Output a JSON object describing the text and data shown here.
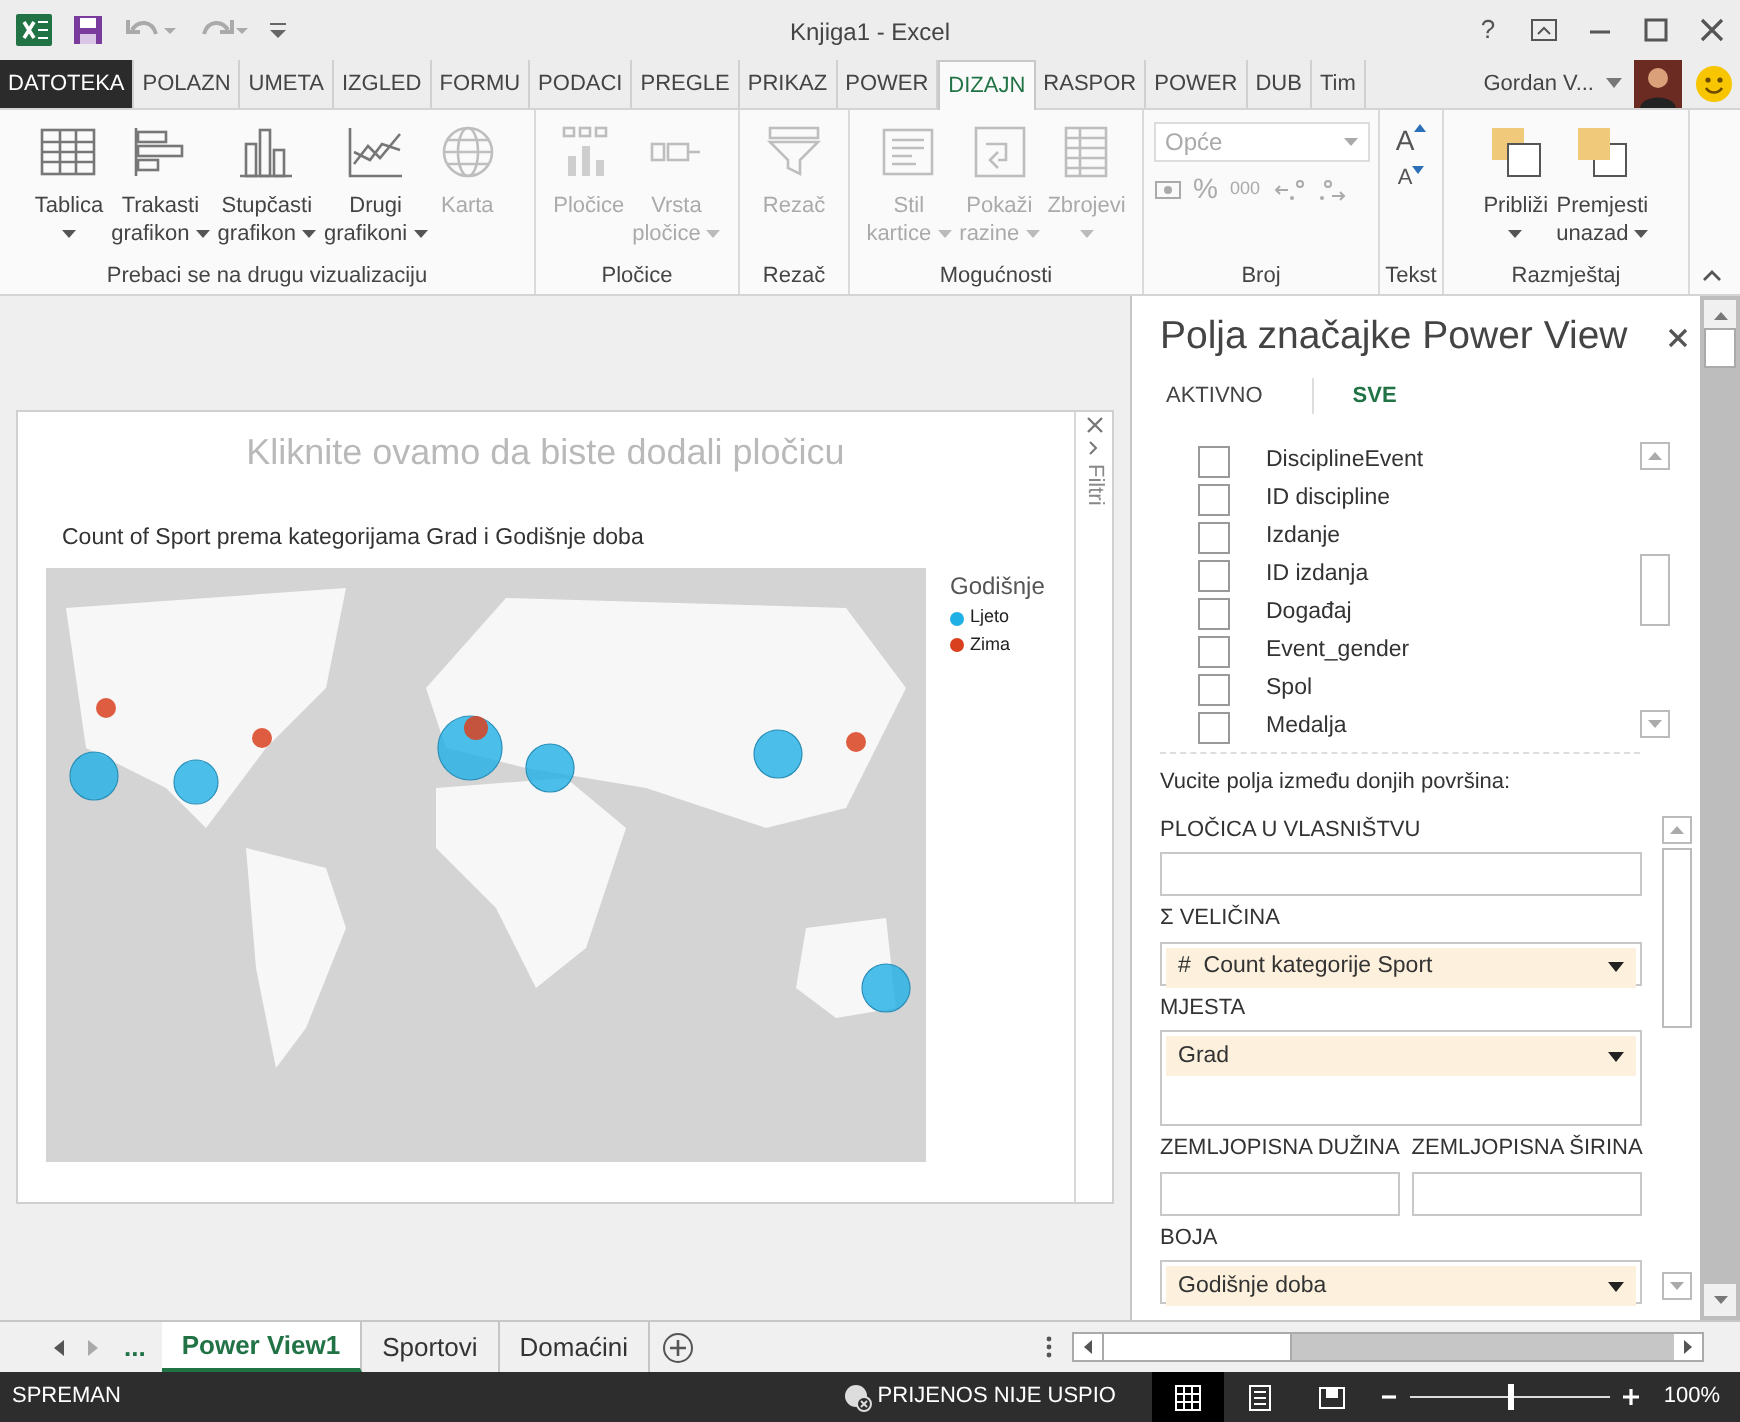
{
  "window": {
    "title": "Knjiga1 - Excel",
    "help": "?"
  },
  "ribbon_tabs": [
    {
      "label": "DATOTEKA",
      "kind": "file",
      "selected": false
    },
    {
      "label": "POLAZN",
      "kind": "tab",
      "selected": false
    },
    {
      "label": "UMETA",
      "kind": "tab",
      "selected": false
    },
    {
      "label": "IZGLED",
      "kind": "tab",
      "selected": false
    },
    {
      "label": "FORMU",
      "kind": "tab",
      "selected": false
    },
    {
      "label": "PODACI",
      "kind": "tab",
      "selected": false
    },
    {
      "label": "PREGLE",
      "kind": "tab",
      "selected": false
    },
    {
      "label": "PRIKAZ",
      "kind": "tab",
      "selected": false
    },
    {
      "label": "POWER",
      "kind": "tab",
      "selected": false
    },
    {
      "label": "DIZAJN",
      "kind": "tab",
      "selected": true
    },
    {
      "label": "RASPOR",
      "kind": "tab",
      "selected": false
    },
    {
      "label": "POWER",
      "kind": "tab",
      "selected": false
    },
    {
      "label": "DUB",
      "kind": "tab",
      "selected": false
    },
    {
      "label": "Tim",
      "kind": "tab",
      "selected": false
    }
  ],
  "account": {
    "name": "Gordan V..."
  },
  "ribbon_groups": [
    {
      "label": "Prebaci se na drugu vizualizaciju",
      "kind": "buttons",
      "buttons": [
        {
          "lines": [
            "Tablica"
          ],
          "dropdown": true,
          "disabled": false
        },
        {
          "lines": [
            "Trakasti",
            "grafikon"
          ],
          "dropdown": true,
          "disabled": false
        },
        {
          "lines": [
            "Stupčasti",
            "grafikon"
          ],
          "dropdown": true,
          "disabled": false
        },
        {
          "lines": [
            "Drugi",
            "grafikoni"
          ],
          "dropdown": true,
          "disabled": false
        },
        {
          "lines": [
            "Karta"
          ],
          "dropdown": false,
          "disabled": true
        }
      ]
    },
    {
      "label": "Pločice",
      "kind": "buttons",
      "buttons": [
        {
          "lines": [
            "Pločice"
          ],
          "dropdown": false,
          "disabled": true
        },
        {
          "lines": [
            "Vrsta",
            "pločice"
          ],
          "dropdown": true,
          "disabled": true
        }
      ]
    },
    {
      "label": "Rezač",
      "kind": "buttons",
      "buttons": [
        {
          "lines": [
            "Rezač"
          ],
          "dropdown": false,
          "disabled": true
        }
      ]
    },
    {
      "label": "Mogućnosti",
      "kind": "buttons",
      "buttons": [
        {
          "lines": [
            "Stil",
            "kartice"
          ],
          "dropdown": true,
          "disabled": true
        },
        {
          "lines": [
            "Pokaži",
            "razine"
          ],
          "dropdown": true,
          "disabled": true
        },
        {
          "lines": [
            "Zbrojevi"
          ],
          "dropdown": true,
          "disabled": true
        }
      ]
    },
    {
      "label": "Broj",
      "kind": "number",
      "format": {
        "value": "Opće",
        "disabled": true
      },
      "small_buttons": [
        "%",
        "000"
      ]
    },
    {
      "label": "Tekst",
      "kind": "font",
      "font_buttons": [
        "A",
        "A"
      ]
    },
    {
      "label": "Razmještaj",
      "kind": "buttons",
      "buttons": [
        {
          "lines": [
            "Približi"
          ],
          "dropdown": true,
          "disabled": false
        },
        {
          "lines": [
            "Premjesti",
            "unazad"
          ],
          "dropdown": true,
          "disabled": false
        }
      ]
    }
  ],
  "canvas": {
    "title_placeholder": "Kliknite ovamo da biste dodali pločicu",
    "filters_label": "Filtri",
    "chart": {
      "title": "Count of Sport prema kategorijama Grad i Godišnje doba",
      "legend": {
        "title": "Godišnje",
        "items": [
          {
            "label": "Ljeto",
            "color": "#1fb0e6"
          },
          {
            "label": "Zima",
            "color": "#d9411e"
          }
        ]
      }
    }
  },
  "fields_pane": {
    "title": "Polja značajke Power View",
    "tabs": [
      {
        "label": "AKTIVNO",
        "selected": false
      },
      {
        "label": "SVE",
        "selected": true
      }
    ],
    "fields": [
      {
        "label": "DisciplineEvent",
        "checked": false
      },
      {
        "label": "ID discipline",
        "checked": false
      },
      {
        "label": "Izdanje",
        "checked": false
      },
      {
        "label": "ID izdanja",
        "checked": false
      },
      {
        "label": "Događaj",
        "checked": false
      },
      {
        "label": "Event_gender",
        "checked": false
      },
      {
        "label": "Spol",
        "checked": false
      },
      {
        "label": "Medalja",
        "checked": false
      }
    ],
    "instruction": "Vucite polja između donjih površina:",
    "areas": [
      {
        "kind": "single",
        "label": "PLOČICA U VLASNIŠTVU"
      },
      {
        "kind": "single",
        "symbol": "Σ",
        "label": "VELIČINA",
        "item": {
          "symbol": "#",
          "label": "Count kategorije Sport"
        }
      },
      {
        "kind": "large",
        "label": "MJESTA",
        "item": {
          "label": "Grad"
        }
      },
      {
        "kind": "pair",
        "wells": [
          {
            "label": "ZEMLJOPISNA DUŽINA"
          },
          {
            "label": "ZEMLJOPISNA ŠIRINA"
          }
        ]
      },
      {
        "kind": "single",
        "label": "BOJA",
        "item": {
          "label": "Godišnje doba"
        }
      }
    ]
  },
  "sheet_tabs": {
    "more": "...",
    "tabs": [
      {
        "label": "Power View1",
        "selected": true
      },
      {
        "label": "Sportovi",
        "selected": false
      },
      {
        "label": "Domaćini",
        "selected": false
      }
    ]
  },
  "status_bar": {
    "mode": "SPREMAN",
    "upload": "PRIJENOS NIJE USPIO",
    "views": [
      {
        "selected": true
      },
      {
        "selected": false
      },
      {
        "selected": false
      }
    ],
    "zoom": {
      "level": 0.5,
      "reading": "100%"
    }
  }
}
